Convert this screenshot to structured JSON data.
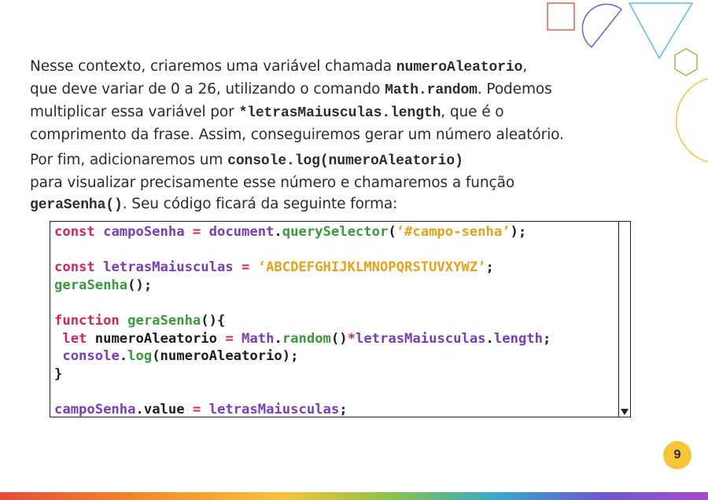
{
  "paragraph1": {
    "t1": "Nesse contexto, criaremos uma variável chamada ",
    "c1": "numeroAleatorio",
    "t2": ",\nque deve variar de 0 a 26, utilizando o comando ",
    "c2": "Math.random",
    "t3": ". Podemos\nmultiplicar essa variável por ",
    "c3": "*letrasMaiusculas.length",
    "t4": ", que é o\ncomprimento da frase. Assim, conseguiremos gerar um número aleatório."
  },
  "paragraph2": {
    "t1": "Por fim, adicionaremos um ",
    "c1": "console.log(numeroAleatorio)",
    "t2": "\npara visualizar precisamente esse número e chamaremos a função\n",
    "c2": "geraSenha()",
    "t3": ". Seu código ficará da seguinte forma:"
  },
  "code_lines": [
    [
      [
        "kw",
        "const "
      ],
      [
        "var",
        "campoSenha "
      ],
      [
        "op",
        "= "
      ],
      [
        "var",
        "document"
      ],
      [
        "plain",
        "."
      ],
      [
        "fn",
        "querySelector"
      ],
      [
        "plain",
        "("
      ],
      [
        "str",
        "‘#campo-senha’"
      ],
      [
        "plain",
        ");"
      ]
    ],
    [],
    [
      [
        "kw",
        "const "
      ],
      [
        "var",
        "letrasMaiusculas "
      ],
      [
        "op",
        "= "
      ],
      [
        "str",
        "‘ABCDEFGHIJKLMNOPQRSTUVXYWZ’"
      ],
      [
        "plain",
        ";"
      ]
    ],
    [
      [
        "fn",
        "geraSenha"
      ],
      [
        "plain",
        "();"
      ]
    ],
    [],
    [
      [
        "kw",
        "function "
      ],
      [
        "fn",
        "geraSenha"
      ],
      [
        "plain",
        "(){"
      ]
    ],
    [
      [
        "plain",
        " "
      ],
      [
        "kw",
        "let "
      ],
      [
        "plain",
        "numeroAleatorio "
      ],
      [
        "op",
        "= "
      ],
      [
        "var",
        "Math"
      ],
      [
        "plain",
        "."
      ],
      [
        "fn",
        "random"
      ],
      [
        "plain",
        "()"
      ],
      [
        "op",
        "*"
      ],
      [
        "var",
        "letrasMaiusculas"
      ],
      [
        "plain",
        "."
      ],
      [
        "var",
        "length"
      ],
      [
        "plain",
        ";"
      ]
    ],
    [
      [
        "plain",
        " "
      ],
      [
        "var",
        "console"
      ],
      [
        "plain",
        "."
      ],
      [
        "fn",
        "log"
      ],
      [
        "plain",
        "(numeroAleatorio);"
      ]
    ],
    [
      [
        "plain",
        "}"
      ]
    ],
    [],
    [
      [
        "var",
        "campoSenha"
      ],
      [
        "plain",
        "."
      ],
      [
        "plain",
        "value "
      ],
      [
        "op",
        "= "
      ],
      [
        "var",
        "letrasMaiusculas"
      ],
      [
        "plain",
        ";"
      ]
    ]
  ],
  "page_number": "9",
  "colors": {
    "keyword": "#d4265c",
    "variable": "#7a3cb8",
    "function": "#3a9a3a",
    "string": "#e8a21a",
    "badge": "#f6c638"
  }
}
